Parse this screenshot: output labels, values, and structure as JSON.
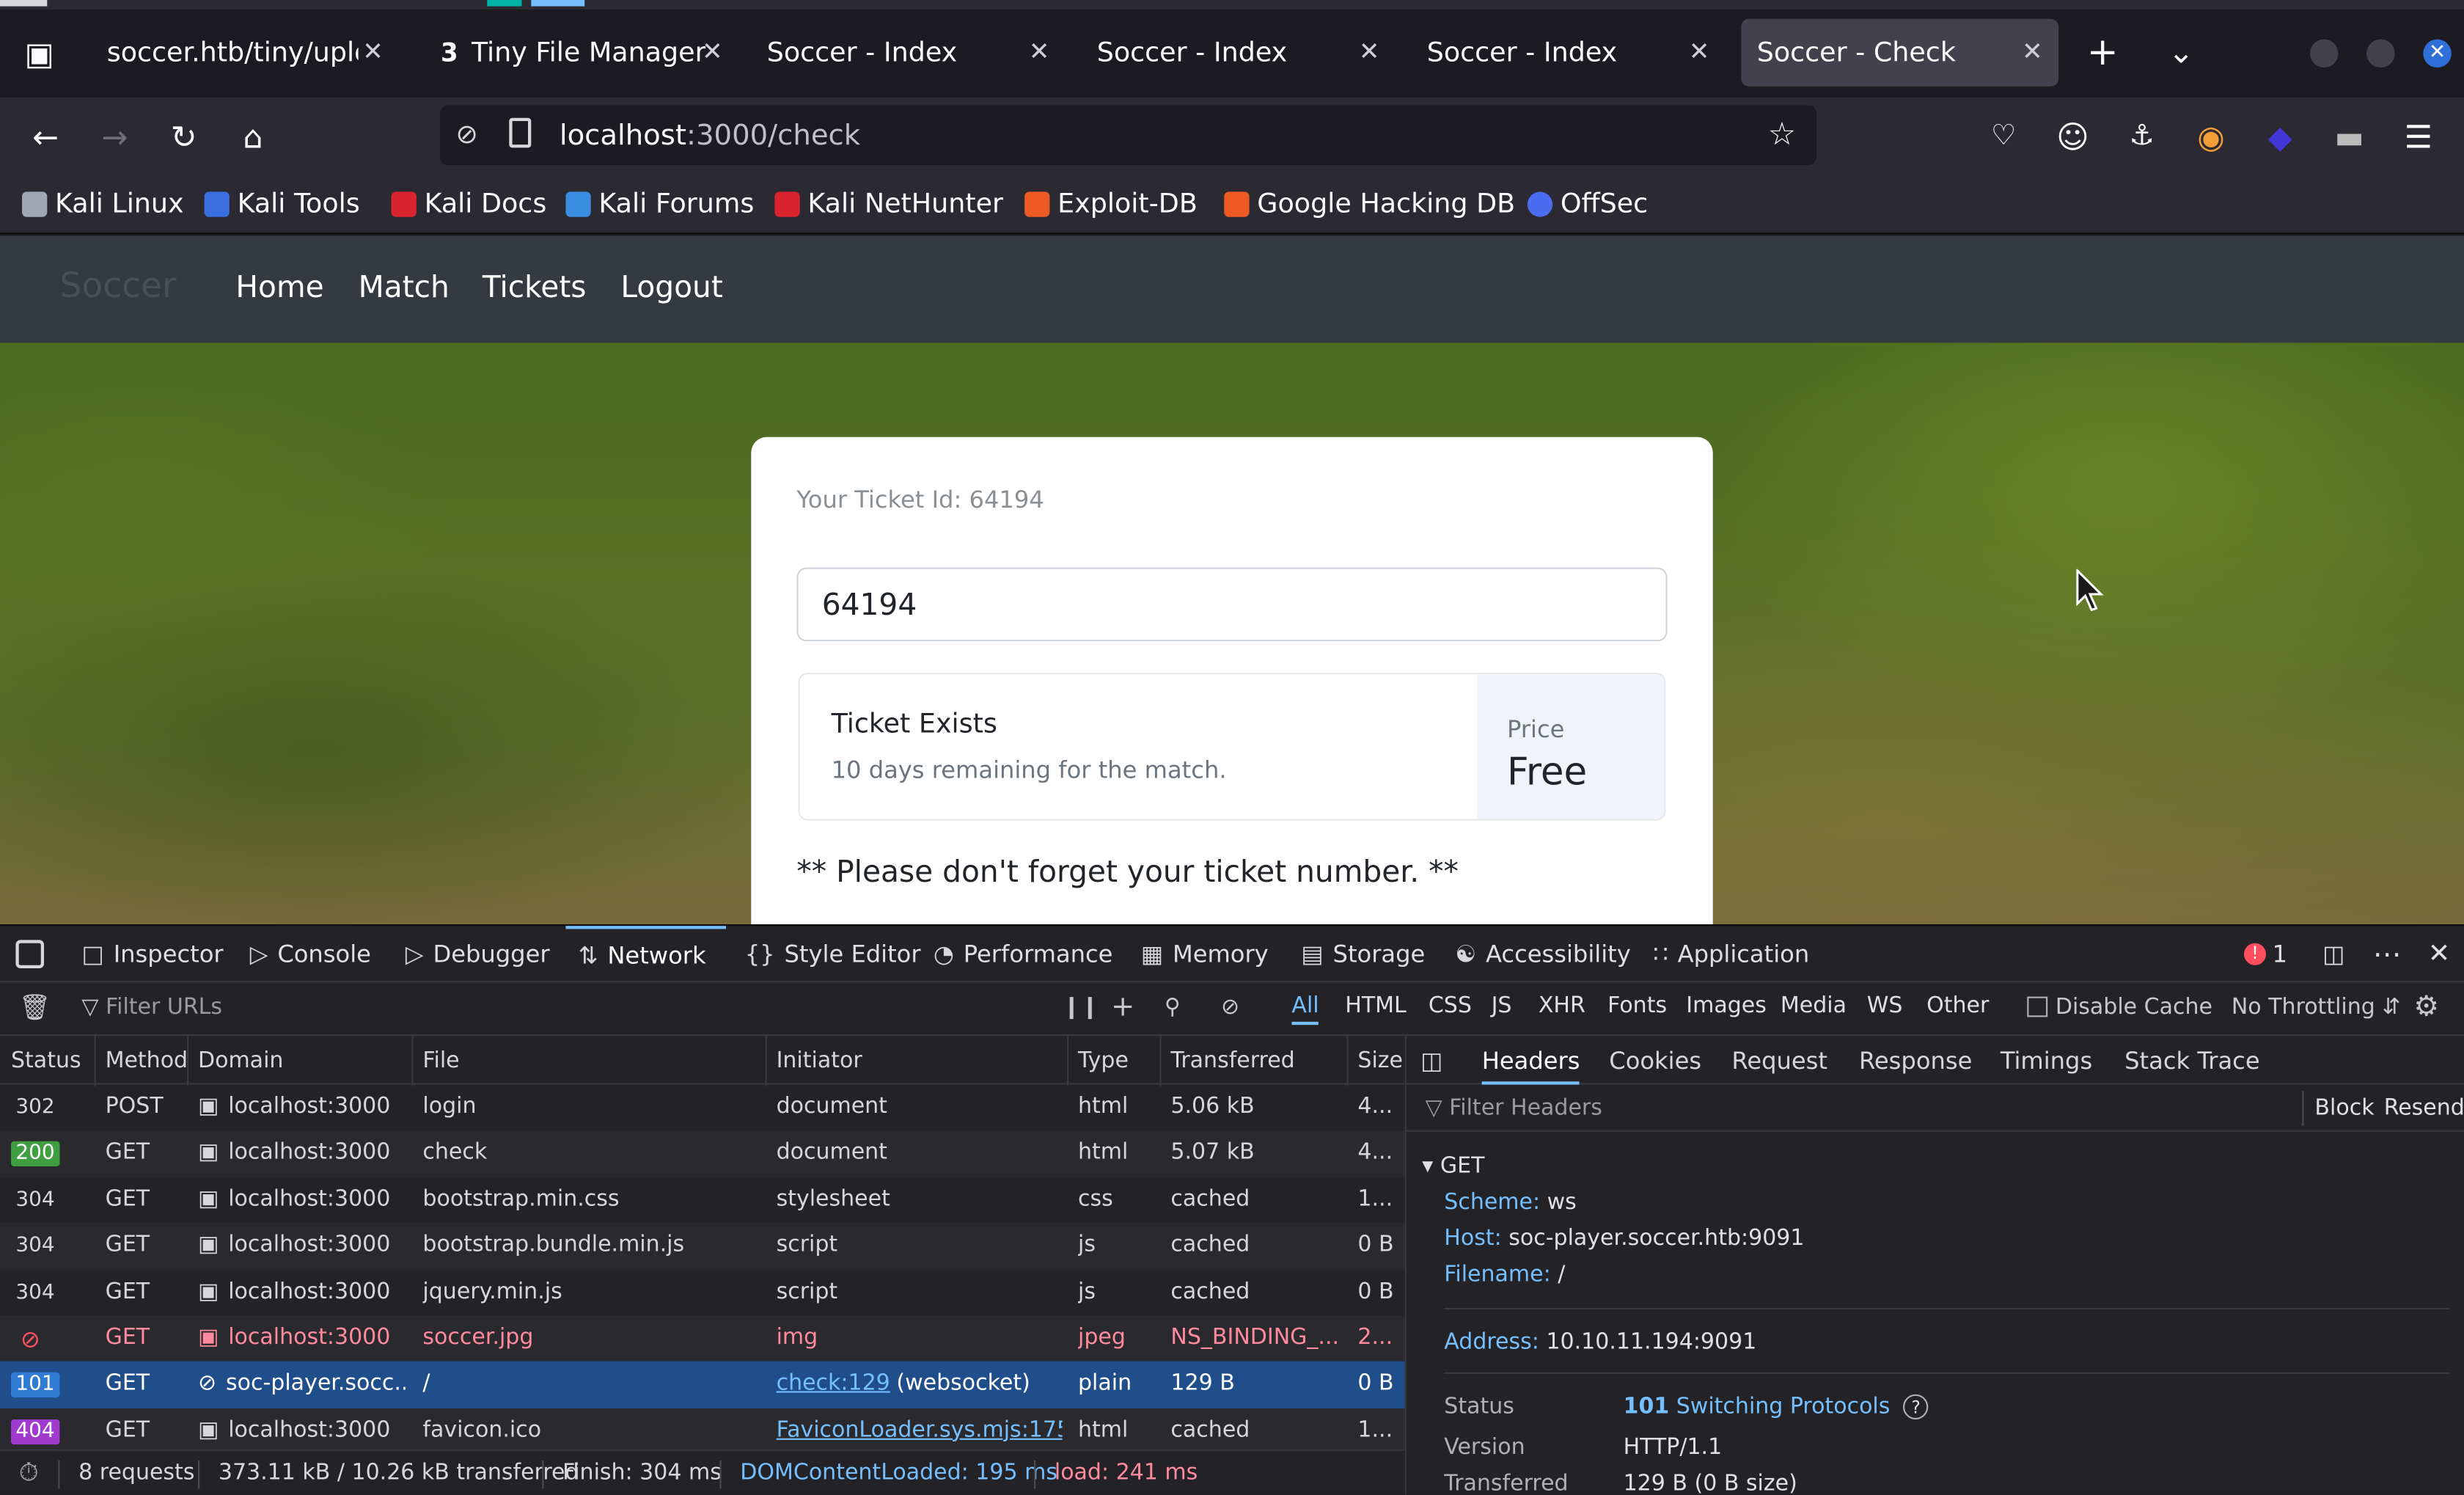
{
  "colors": {
    "accent": "#75bfff",
    "selected_row": "#204e8a",
    "status_200": "#3f9e3f",
    "status_101": "#2f7bd3",
    "status_404": "#a13bd0",
    "error_red": "#ff4f5e"
  },
  "browser": {
    "tabs": [
      {
        "label": "soccer.htb/tiny/uplo"
      },
      {
        "label": "Tiny File Manager",
        "icon": "3"
      },
      {
        "label": "Soccer - Index"
      },
      {
        "label": "Soccer - Index"
      },
      {
        "label": "Soccer - Index"
      },
      {
        "label": "Soccer - Check"
      }
    ],
    "url_host": "localhost",
    "url_rest": ":3000/check",
    "bookmarks": [
      "Kali Linux",
      "Kali Tools",
      "Kali Docs",
      "Kali Forums",
      "Kali NetHunter",
      "Exploit-DB",
      "Google Hacking DB",
      "OffSec"
    ]
  },
  "site": {
    "brand": "Soccer",
    "nav": [
      "Home",
      "Match",
      "Tickets",
      "Logout"
    ],
    "ticket_label": "Your Ticket Id: 64194",
    "ticket_value": "64194",
    "result_title": "Ticket Exists",
    "result_sub": "10 days remaining for the match.",
    "price_label": "Price",
    "price_value": "Free",
    "note": "** Please don't forget your ticket number. **"
  },
  "devtools": {
    "tabs": [
      "Inspector",
      "Console",
      "Debugger",
      "Network",
      "Style Editor",
      "Performance",
      "Memory",
      "Storage",
      "Accessibility",
      "Application"
    ],
    "error_count": "1",
    "filter_placeholder": "Filter URLs",
    "type_filters": [
      "All",
      "HTML",
      "CSS",
      "JS",
      "XHR",
      "Fonts",
      "Images",
      "Media",
      "WS",
      "Other"
    ],
    "disable_cache": "Disable Cache",
    "throttling": "No Throttling",
    "columns": [
      "Status",
      "Method",
      "Domain",
      "File",
      "Initiator",
      "Type",
      "Transferred",
      "Size"
    ],
    "requests": [
      {
        "status": "302",
        "method": "POST",
        "domain": "localhost:3000",
        "file": "login",
        "initiator": "document",
        "type": "html",
        "transferred": "5.06 kB",
        "size": "4..."
      },
      {
        "status": "200",
        "method": "GET",
        "domain": "localhost:3000",
        "file": "check",
        "initiator": "document",
        "type": "html",
        "transferred": "5.07 kB",
        "size": "4..."
      },
      {
        "status": "304",
        "method": "GET",
        "domain": "localhost:3000",
        "file": "bootstrap.min.css",
        "initiator": "stylesheet",
        "type": "css",
        "transferred": "cached",
        "size": "1..."
      },
      {
        "status": "304",
        "method": "GET",
        "domain": "localhost:3000",
        "file": "bootstrap.bundle.min.js",
        "initiator": "script",
        "type": "js",
        "transferred": "cached",
        "size": "0 B"
      },
      {
        "status": "304",
        "method": "GET",
        "domain": "localhost:3000",
        "file": "jquery.min.js",
        "initiator": "script",
        "type": "js",
        "transferred": "cached",
        "size": "0 B"
      },
      {
        "status": "",
        "method": "GET",
        "domain": "localhost:3000",
        "file": "soccer.jpg",
        "initiator": "img",
        "type": "jpeg",
        "transferred": "NS_BINDING_...",
        "size": "2..."
      },
      {
        "status": "101",
        "method": "GET",
        "domain": "soc-player.socc...",
        "file": "/",
        "initiator": "check:129",
        "initiator_extra": "(websocket)",
        "type": "plain",
        "transferred": "129 B",
        "size": "0 B"
      },
      {
        "status": "404",
        "method": "GET",
        "domain": "localhost:3000",
        "file": "favicon.ico",
        "initiator": "FaviconLoader.sys.mjs:175 (...",
        "type": "html",
        "transferred": "cached",
        "size": "1..."
      }
    ],
    "panel_tabs": [
      "Headers",
      "Cookies",
      "Request",
      "Response",
      "Timings",
      "Stack Trace"
    ],
    "filter_headers": "Filter Headers",
    "block": "Block",
    "resend": "Resend",
    "section": "GET",
    "scheme_k": "Scheme:",
    "scheme_v": "ws",
    "host_k": "Host:",
    "host_v": "soc-player.soccer.htb:9091",
    "filename_k": "Filename:",
    "filename_v": "/",
    "address_k": "Address:",
    "address_v": "10.10.11.194:9091",
    "status_k": "Status",
    "status_code": "101",
    "status_text": "Switching Protocols",
    "version_k": "Version",
    "version_v": "HTTP/1.1",
    "transferred_k": "Transferred",
    "transferred_v": "129 B (0 B size)",
    "summary": {
      "requests": "8 requests",
      "transferred": "373.11 kB / 10.26 kB transferred",
      "finish": "Finish: 304 ms",
      "dcl": "DOMContentLoaded: 195 ms",
      "load": "load: 241 ms"
    }
  }
}
